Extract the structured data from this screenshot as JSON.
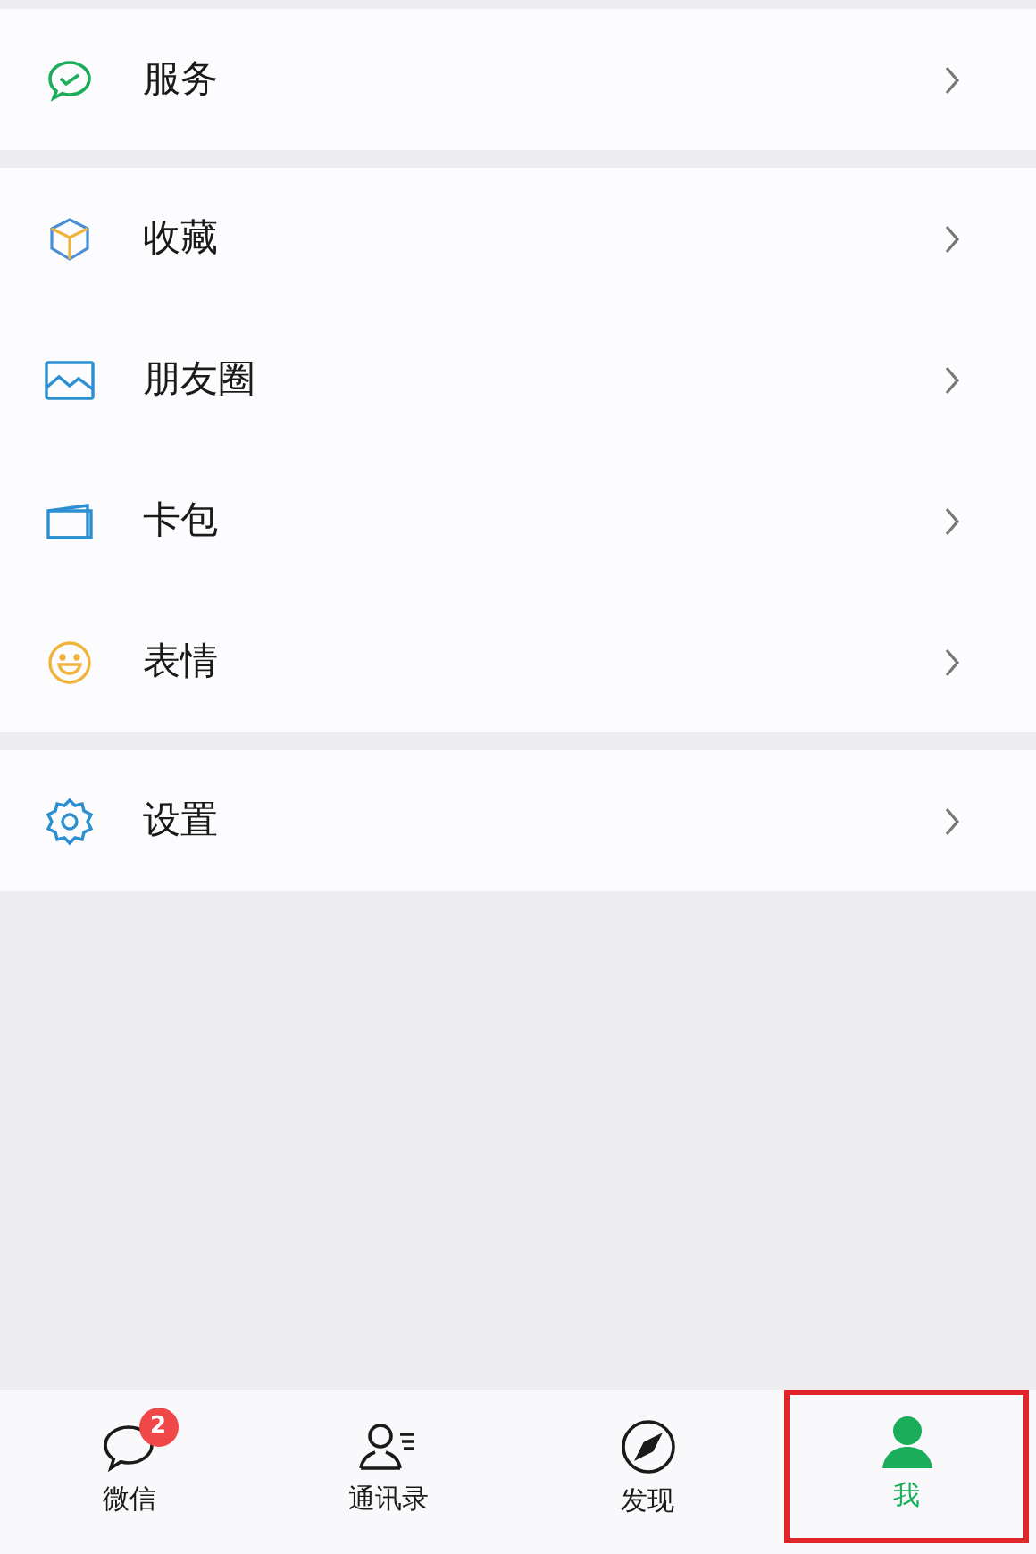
{
  "groups": [
    {
      "items": [
        {
          "label": "服务",
          "kind": "service"
        }
      ]
    },
    {
      "items": [
        {
          "label": "收藏",
          "kind": "favorites"
        },
        {
          "label": "朋友圈",
          "kind": "moments"
        },
        {
          "label": "卡包",
          "kind": "cards"
        },
        {
          "label": "表情",
          "kind": "stickers"
        }
      ]
    },
    {
      "items": [
        {
          "label": "设置",
          "kind": "settings"
        }
      ]
    }
  ],
  "tab_bar": [
    {
      "label": "微信",
      "kind": "chat",
      "selected": false,
      "badge": "2",
      "highlighted": false
    },
    {
      "label": "通讯录",
      "kind": "contacts",
      "selected": false,
      "highlighted": false
    },
    {
      "label": "发现",
      "kind": "discover",
      "selected": false,
      "highlighted": false
    },
    {
      "label": "我",
      "kind": "me",
      "selected": true,
      "highlighted": true
    }
  ]
}
